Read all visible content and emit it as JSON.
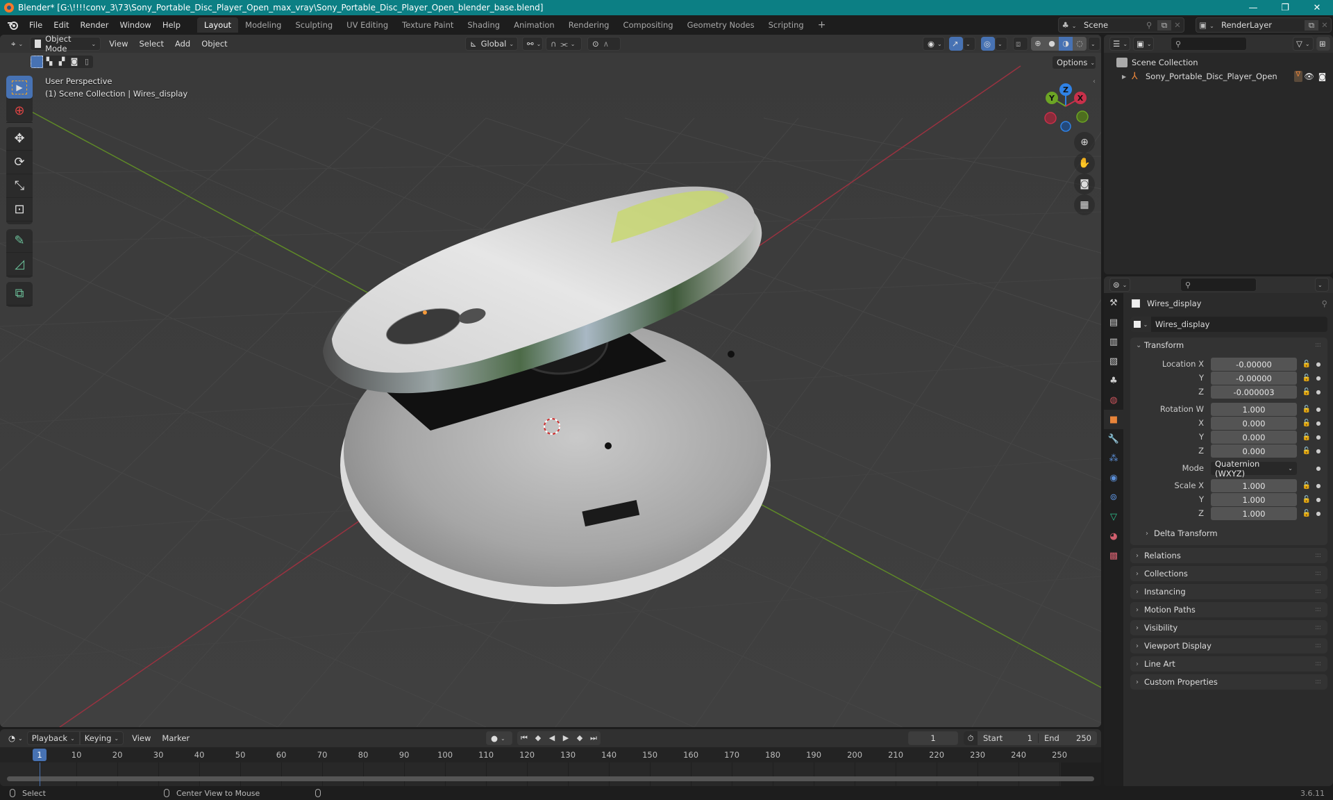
{
  "window": {
    "title": "Blender* [G:\\!!!!conv_3\\73\\Sony_Portable_Disc_Player_Open_max_vray\\Sony_Portable_Disc_Player_Open_blender_base.blend]",
    "minimize": "—",
    "maximize": "❐",
    "close": "✕"
  },
  "menu": {
    "items": [
      "File",
      "Edit",
      "Render",
      "Window",
      "Help"
    ]
  },
  "workspaces": {
    "tabs": [
      "Layout",
      "Modeling",
      "Sculpting",
      "UV Editing",
      "Texture Paint",
      "Shading",
      "Animation",
      "Rendering",
      "Compositing",
      "Geometry Nodes",
      "Scripting"
    ],
    "active": "Layout",
    "add": "+"
  },
  "scene": {
    "name": "Scene",
    "view_layer": "RenderLayer"
  },
  "viewport": {
    "mode": "Object Mode",
    "menus": [
      "View",
      "Select",
      "Add",
      "Object"
    ],
    "orientation": "Global",
    "options_label": "Options",
    "perspective": "User Perspective",
    "context": "(1) Scene Collection | Wires_display",
    "gizmo": {
      "x": "X",
      "y": "Y",
      "z": "Z"
    },
    "colors": {
      "x_axis": "#c8304a",
      "y_axis": "#6ca424",
      "z_axis": "#2f82e6",
      "accent": "#4772b3"
    }
  },
  "outliner": {
    "root": "Scene Collection",
    "items": [
      {
        "name": "Sony_Portable_Disc_Player_Open",
        "type": "empty"
      }
    ]
  },
  "properties": {
    "object_name": "Wires_display",
    "datablock_name": "Wires_display",
    "transform": {
      "title": "Transform",
      "location": {
        "label": "Location X",
        "x": "-0.00000",
        "y": "-0.00000",
        "z": "-0.000003"
      },
      "rotation": {
        "label": "Rotation W",
        "w": "1.000",
        "x": "0.000",
        "y": "0.000",
        "z": "0.000"
      },
      "mode_label": "Mode",
      "mode_value": "Quaternion (WXYZ)",
      "scale": {
        "label": "Scale X",
        "x": "1.000",
        "y": "1.000",
        "z": "1.000"
      },
      "axis_labels": {
        "x": "X",
        "y": "Y",
        "z": "Z"
      },
      "delta": "Delta Transform"
    },
    "panels": [
      "Relations",
      "Collections",
      "Instancing",
      "Motion Paths",
      "Visibility",
      "Viewport Display",
      "Line Art",
      "Custom Properties"
    ]
  },
  "timeline": {
    "menus": [
      "Playback",
      "Keying",
      "View",
      "Marker"
    ],
    "current_frame": "1",
    "start_label": "Start",
    "start": "1",
    "end_label": "End",
    "end": "250",
    "ticks": [
      "10",
      "20",
      "30",
      "40",
      "50",
      "60",
      "70",
      "80",
      "90",
      "100",
      "110",
      "120",
      "130",
      "140",
      "150",
      "160",
      "170",
      "180",
      "190",
      "200",
      "210",
      "220",
      "230",
      "240",
      "250"
    ],
    "playhead": "1"
  },
  "status": {
    "left": "Select",
    "middle": "Center View to Mouse",
    "version": "3.6.11"
  }
}
